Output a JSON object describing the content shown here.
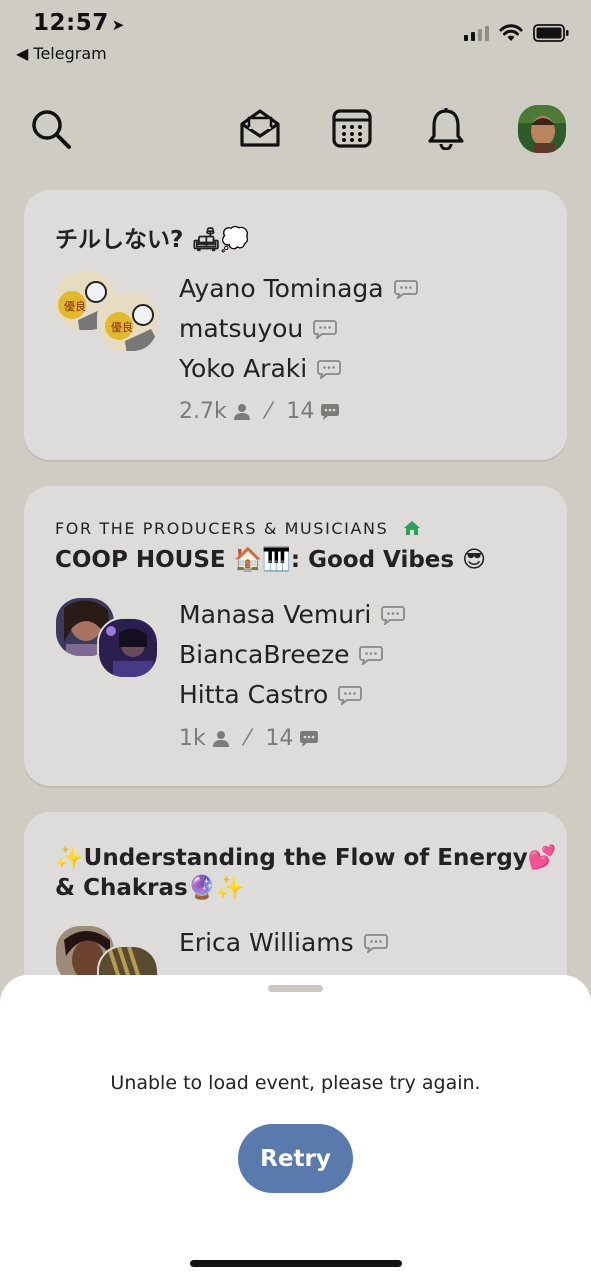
{
  "status": {
    "time": "12:57",
    "back_app": "◀ Telegram"
  },
  "nav": {
    "icons": [
      "search-icon",
      "envelope-icon",
      "calendar-icon",
      "bell-icon",
      "profile-avatar"
    ]
  },
  "rooms": [
    {
      "club": "",
      "title": "チルしない? 🛋💭",
      "speakers": [
        "Ayano Tominaga",
        "matsuyou",
        "Yoko Araki"
      ],
      "listeners": "2.7k",
      "speaker_count": "14"
    },
    {
      "club": "FOR THE PRODUCERS & MUSICIANS",
      "title": "COOP HOUSE 🏠🎹: Good Vibes 😎",
      "speakers": [
        "Manasa Vemuri",
        "BiancaBreeze",
        "Hitta Castro"
      ],
      "listeners": "1k",
      "speaker_count": "14"
    },
    {
      "club": "",
      "title_line1": "✨Understanding the Flow of Energy💕",
      "title_line2": "& Chakras🔮✨",
      "speakers": [
        "Erica Williams"
      ]
    }
  ],
  "sheet": {
    "message": "Unable to load event, please try again.",
    "retry_label": "Retry"
  },
  "colors": {
    "background": "#cfccc4",
    "card": "#dddcda",
    "accent": "#5a79ad",
    "house_icon": "#27a35a"
  }
}
